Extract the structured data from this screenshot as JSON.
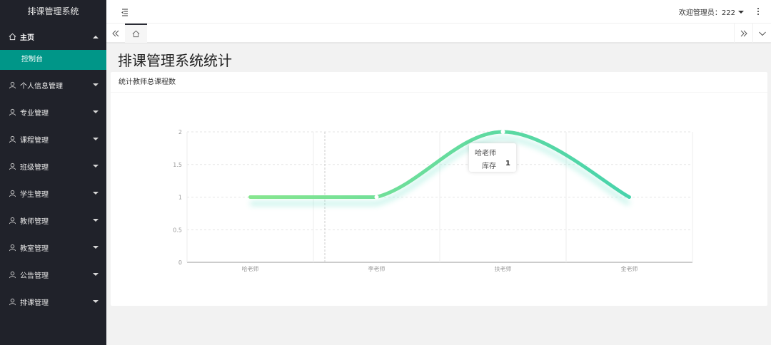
{
  "app": {
    "title": "排课管理系统"
  },
  "sidebar": {
    "home": {
      "label": "主页"
    },
    "home_sub": {
      "label": "控制台"
    },
    "items": [
      {
        "label": "个人信息管理"
      },
      {
        "label": "专业管理"
      },
      {
        "label": "课程管理"
      },
      {
        "label": "班级管理"
      },
      {
        "label": "学生管理"
      },
      {
        "label": "教师管理"
      },
      {
        "label": "教室管理"
      },
      {
        "label": "公告管理"
      },
      {
        "label": "排课管理"
      }
    ]
  },
  "header": {
    "user_label": "欢迎管理员：222"
  },
  "page": {
    "title": "排课管理系统统计"
  },
  "card": {
    "title": "统计教师总课程数"
  },
  "tooltip": {
    "category": "哈老师",
    "series": "库存",
    "value": "1"
  },
  "colors": {
    "sidebar_bg": "#20222a",
    "accent": "#009688",
    "line_start": "#91e98a",
    "line_end": "#3dd0b0"
  },
  "chart_data": {
    "type": "line",
    "smooth": true,
    "categories": [
      "哈老师",
      "李老师",
      "扶老师",
      "金老师"
    ],
    "series": [
      {
        "name": "库存",
        "values": [
          1,
          1,
          2,
          1
        ]
      }
    ],
    "yticks": [
      "0",
      "0.5",
      "1",
      "1.5",
      "2"
    ],
    "ylim": [
      0,
      2
    ],
    "grid": true
  }
}
